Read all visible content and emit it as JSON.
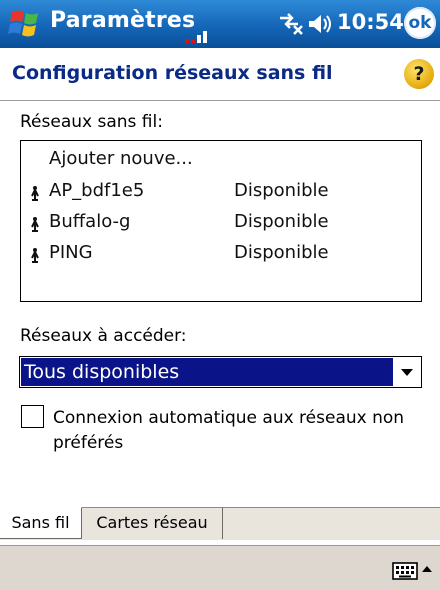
{
  "titlebar": {
    "app_title": "Paramètres",
    "time": "10:54",
    "ok_label": "ok"
  },
  "header": {
    "title": "Configuration réseaux sans fil",
    "help_label": "?"
  },
  "networks": {
    "label": "Réseaux sans fil:",
    "add_new": "Ajouter nouve...",
    "items": [
      {
        "name": "AP_bdf1e5",
        "status": "Disponible"
      },
      {
        "name": "Buffalo-g",
        "status": "Disponible"
      },
      {
        "name": "PING",
        "status": "Disponible"
      }
    ]
  },
  "access": {
    "label": "Réseaux à accéder:",
    "selected": "Tous disponibles"
  },
  "auto_connect": {
    "label": "Connexion automatique aux réseaux non préférés",
    "checked": false
  },
  "tabs": [
    {
      "label": "Sans fil",
      "active": true
    },
    {
      "label": "Cartes réseau",
      "active": false
    }
  ],
  "colors": {
    "titlebar_blue": "#1466b8",
    "header_text": "#0a2a86",
    "selection": "#0a1488"
  },
  "icons": {
    "start": "windows-flag-icon",
    "signal": "signal-strength-icon",
    "connectivity": "connectivity-icon",
    "volume": "speaker-icon",
    "help": "help-icon",
    "network": "antenna-icon",
    "keyboard": "keyboard-icon"
  }
}
